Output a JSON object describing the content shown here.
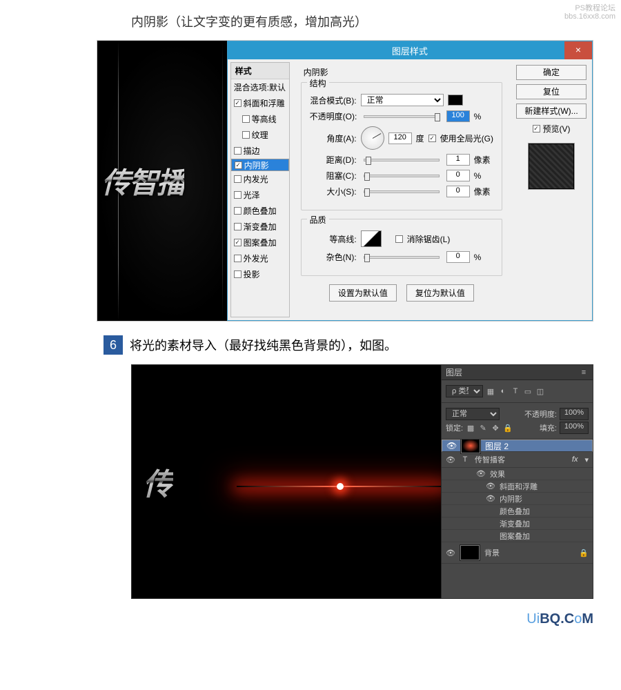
{
  "watermark": {
    "l1": "PS教程论坛",
    "l2": "bbs.16xx8.com"
  },
  "caption1": "内阴影（让文字变的更有质感，增加高光）",
  "step6": {
    "num": "6",
    "text": "将光的素材导入（最好找纯黑色背景的），如图。"
  },
  "metalText": "传智播",
  "metalText2": "传",
  "dlg": {
    "title": "图层样式",
    "close": "×",
    "left": {
      "header": "样式",
      "items": [
        {
          "label": "混合选项:默认",
          "checked": false,
          "cb": false
        },
        {
          "label": "斜面和浮雕",
          "checked": true,
          "cb": true
        },
        {
          "label": "等高线",
          "checked": false,
          "cb": true,
          "indent": true
        },
        {
          "label": "纹理",
          "checked": false,
          "cb": true,
          "indent": true
        },
        {
          "label": "描边",
          "checked": false,
          "cb": true
        },
        {
          "label": "内阴影",
          "checked": true,
          "cb": true,
          "sel": true
        },
        {
          "label": "内发光",
          "checked": false,
          "cb": true
        },
        {
          "label": "光泽",
          "checked": false,
          "cb": true
        },
        {
          "label": "颜色叠加",
          "checked": false,
          "cb": true
        },
        {
          "label": "渐变叠加",
          "checked": false,
          "cb": true
        },
        {
          "label": "图案叠加",
          "checked": true,
          "cb": true
        },
        {
          "label": "外发光",
          "checked": false,
          "cb": true
        },
        {
          "label": "投影",
          "checked": false,
          "cb": true
        }
      ]
    },
    "mid": {
      "title": "内阴影",
      "g1": "结构",
      "blendLabel": "混合模式(B):",
      "blendValue": "正常",
      "opacityLabel": "不透明度(O):",
      "opacityValue": "100",
      "opacityUnit": "%",
      "angleLabel": "角度(A):",
      "angleValue": "120",
      "angleUnit": "度",
      "globalLabel": "使用全局光(G)",
      "distLabel": "距离(D):",
      "distValue": "1",
      "distUnit": "像素",
      "chokeLabel": "阻塞(C):",
      "chokeValue": "0",
      "chokeUnit": "%",
      "sizeLabel": "大小(S):",
      "sizeValue": "0",
      "sizeUnit": "像素",
      "g2": "品质",
      "contourLabel": "等高线:",
      "antiLabel": "消除锯齿(L)",
      "noiseLabel": "杂色(N):",
      "noiseValue": "0",
      "noiseUnit": "%",
      "btnDef": "设置为默认值",
      "btnReset": "复位为默认值"
    },
    "right": {
      "ok": "确定",
      "cancel": "复位",
      "new": "新建样式(W)...",
      "previewLabel": "预览(V)"
    }
  },
  "panel": {
    "tab": "图层",
    "kindLabel": "ρ 类型",
    "kindValue": "",
    "modeValue": "正常",
    "opacityLabel": "不透明度:",
    "opacityValue": "100%",
    "lockLabel": "锁定:",
    "fillLabel": "填充:",
    "fillValue": "100%",
    "layers": [
      {
        "name": "图层 2",
        "sel": true,
        "eye": true,
        "thumb": "flare"
      },
      {
        "name": "传智播客",
        "eye": true,
        "type": "T",
        "fx": "fx"
      },
      {
        "name": "效果",
        "sub": 1,
        "eye": true
      },
      {
        "name": "斜面和浮雕",
        "sub": 2,
        "eye": true
      },
      {
        "name": "内阴影",
        "sub": 2,
        "eye": true
      },
      {
        "name": "颜色叠加",
        "sub": 2,
        "eye": false
      },
      {
        "name": "渐变叠加",
        "sub": 2,
        "eye": false
      },
      {
        "name": "图案叠加",
        "sub": 2,
        "eye": false
      },
      {
        "name": "背景",
        "eye": true,
        "thumb": "black",
        "locked": true
      }
    ]
  },
  "footer": {
    "a": "U",
    "b": "i",
    "c": "BQ.C",
    "d": "o",
    "e": "M"
  }
}
